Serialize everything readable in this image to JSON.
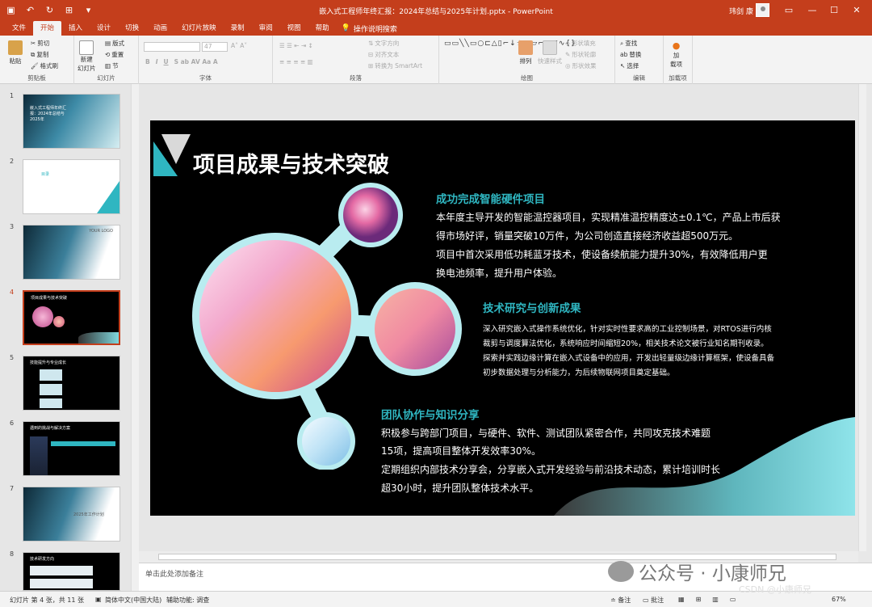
{
  "app": {
    "document_title": "嵌入式工程师年终汇报：2024年总结与2025年计划.pptx  -  PowerPoint",
    "user_name": "玮剑 康",
    "colors": {
      "accent": "#c43e1c",
      "teal": "#2fb6c1",
      "slide_bg": "#000000"
    }
  },
  "quick_access": {
    "icons": [
      "save-icon",
      "undo-icon",
      "redo-icon",
      "present-icon",
      "customize-icon"
    ]
  },
  "window_controls": {
    "ribbon_display": "▭",
    "minimize": "—",
    "maximize": "☐",
    "close": "✕"
  },
  "tabs": [
    {
      "label": "文件"
    },
    {
      "label": "开始"
    },
    {
      "label": "插入"
    },
    {
      "label": "设计"
    },
    {
      "label": "切换"
    },
    {
      "label": "动画"
    },
    {
      "label": "幻灯片放映"
    },
    {
      "label": "录制"
    },
    {
      "label": "审阅"
    },
    {
      "label": "视图"
    },
    {
      "label": "帮助"
    }
  ],
  "tell_me": "操作说明搜索",
  "ribbon": {
    "clipboard": {
      "label": "剪贴板",
      "paste": "粘贴",
      "cut": "剪切",
      "copy": "复制",
      "format_painter": "格式刷"
    },
    "slides": {
      "label": "幻灯片",
      "new_slide": "新建",
      "new_slide2": "幻灯片",
      "layout": "版式",
      "reset": "重置",
      "section": "节"
    },
    "font": {
      "label": "字体",
      "size": "47"
    },
    "paragraph": {
      "label": "段落",
      "text_direction": "文字方向",
      "align_text": "对齐文本",
      "smartart": "转换为 SmartArt"
    },
    "drawing": {
      "label": "绘图",
      "arrange": "排列",
      "quick_styles": "快速样式",
      "shape_fill": "形状填充",
      "shape_outline": "形状轮廓",
      "shape_effects": "形状效果"
    },
    "editing": {
      "label": "编辑",
      "find": "查找",
      "replace": "替换",
      "select": "选择"
    },
    "addins": {
      "label": "加载项",
      "addins_btn": "加",
      "addins_btn2": "载项"
    }
  },
  "thumbnails": [
    {
      "num": "1",
      "text": "嵌入式工程师年终汇报：2024年总结与2025年"
    },
    {
      "num": "2",
      "text": "目录"
    },
    {
      "num": "3",
      "text": "YOUR LOGO"
    },
    {
      "num": "4",
      "text": "项目成果与技术突破"
    },
    {
      "num": "5",
      "text": "技能提升与专业成长"
    },
    {
      "num": "6",
      "text": "遇到的挑战与解决方案"
    },
    {
      "num": "7",
      "text": "2025年工作计划"
    },
    {
      "num": "8",
      "text": "技术研发方向"
    }
  ],
  "slide": {
    "title": "项目成果与技术突破",
    "s1_head": "成功完成智能硬件项目",
    "s1_l1": "本年度主导开发的智能温控器项目，实现精准温控精度达±0.1℃，产品上市后获",
    "s1_l2": "得市场好评，销量突破10万件，为公司创造直接经济收益超500万元。",
    "s1_l3": "项目中首次采用低功耗蓝牙技术，使设备续航能力提升30%，有效降低用户更",
    "s1_l4": "换电池频率，提升用户体验。",
    "s2_head": "技术研究与创新成果",
    "s2_l1": "深入研究嵌入式操作系统优化，针对实时性要求高的工业控制场景，对RTOS进行内核",
    "s2_l2": "裁剪与调度算法优化，系统响应时间缩短20%，相关技术论文被行业知名期刊收录。",
    "s2_l3": "探索并实践边缘计算在嵌入式设备中的应用，开发出轻量级边缘计算框架，使设备具备",
    "s2_l4": "初步数据处理与分析能力，为后续物联网项目奠定基础。",
    "s3_head": "团队协作与知识分享",
    "s3_l1": "积极参与跨部门项目，与硬件、软件、测试团队紧密合作，共同攻克技术难题",
    "s3_l2": "15项，提高项目整体开发效率30%。",
    "s3_l3": "定期组织内部技术分享会，分享嵌入式开发经验与前沿技术动态，累计培训时长",
    "s3_l4": "超30小时，提升团队整体技术水平。"
  },
  "notes_placeholder": "单击此处添加备注",
  "watermark": "公众号 · 小康师兄",
  "csdn_mark": "CSDN @小康师兄",
  "status": {
    "slide_info": "幻灯片 第 4 张，共 11 张",
    "language": "简体中文(中国大陆)",
    "accessibility": "辅助功能: 调查",
    "notes_btn": "备注",
    "comments_btn": "批注",
    "zoom": "67%"
  }
}
